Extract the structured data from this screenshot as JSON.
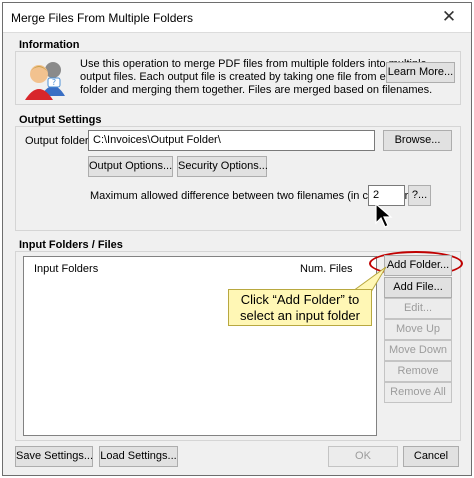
{
  "window": {
    "title": "Merge Files From Multiple Folders",
    "close_glyph": "✕"
  },
  "information": {
    "title": "Information",
    "icon": "users-help-icon",
    "lines": [
      "Use this operation to merge PDF files from multiple folders into multiple",
      "output files. Each output file is created by taking one file from each input",
      "folder and merging them together. Files are merged based on filenames."
    ],
    "learn_more_label": "Learn More..."
  },
  "output_settings": {
    "title": "Output Settings",
    "output_folder_label": "Output folder:",
    "output_folder_value": "C:\\Invoices\\Output Folder\\",
    "browse_label": "Browse...",
    "output_options_label": "Output Options...",
    "security_options_label": "Security Options...",
    "max_diff_label": "Maximum allowed difference between two filenames (in characters):",
    "max_diff_value": "2",
    "help_label": "?..."
  },
  "input_folders": {
    "title": "Input Folders / Files",
    "columns": [
      "Input Folders",
      "Num. Files"
    ],
    "rows": [],
    "add_folder_label": "Add Folder...",
    "add_file_label": "Add File...",
    "edit_label": "Edit...",
    "move_up_label": "Move Up",
    "move_down_label": "Move Down",
    "remove_label": "Remove",
    "remove_all_label": "Remove All"
  },
  "callout": {
    "line1": "Click “Add Folder” to",
    "line2": "select an input folder",
    "highlight_color": "#c00000",
    "background_color": "#fff7b5"
  },
  "footer": {
    "save_settings_label": "Save Settings...",
    "load_settings_label": "Load Settings...",
    "ok_label": "OK",
    "cancel_label": "Cancel"
  }
}
